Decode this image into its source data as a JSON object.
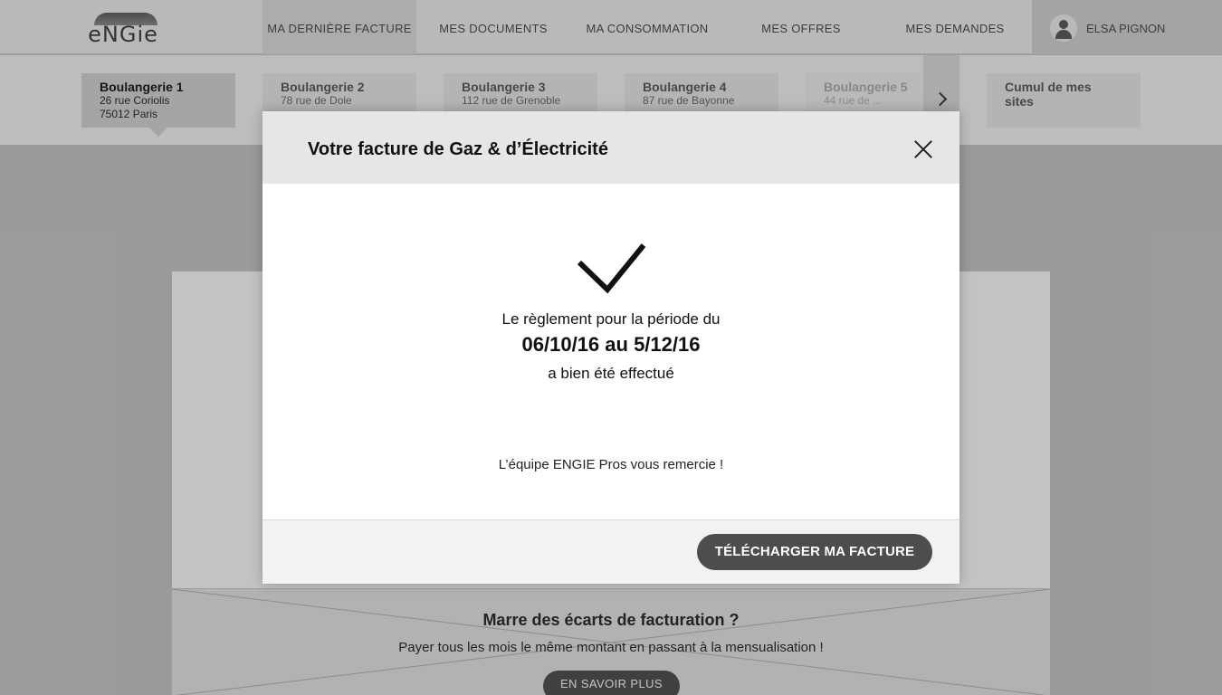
{
  "brand": {
    "logo_text": "eNGie"
  },
  "nav": {
    "items": [
      {
        "label": "MA DERNIÈRE FACTURE"
      },
      {
        "label": "MES DOCUMENTS"
      },
      {
        "label": "MA CONSOMMATION"
      },
      {
        "label": "MES OFFRES"
      },
      {
        "label": "MES DEMANDES"
      }
    ],
    "user_name": "ELSA PIGNON"
  },
  "sites": {
    "cards": [
      {
        "name": "Boulangerie 1",
        "street": "26 rue Coriolis",
        "city": "75012 Paris"
      },
      {
        "name": "Boulangerie 2",
        "street": "78 rue de Dole"
      },
      {
        "name": "Boulangerie 3",
        "street": "112 rue de Grenoble"
      },
      {
        "name": "Boulangerie 4",
        "street": "87 rue de Bayonne"
      },
      {
        "name": "Boulangerie 5",
        "street": "44 rue de ..."
      }
    ],
    "total_label": "Cumul de mes sites"
  },
  "promo": {
    "title": "Marre des écarts de facturation ?",
    "text": "Payer tous les mois le même montant en passant à la mensualisation !",
    "button": "EN SAVOIR PLUS"
  },
  "modal": {
    "title": "Votre facture de Gaz & d’Électricité",
    "line1": "Le règlement pour la période du",
    "dates": "06/10/16 au 5/12/16",
    "line3": "a bien été effectué",
    "thanks": "L’équipe ENGIE Pros vous remercie !",
    "download_button": "TÉLÉCHARGER MA FACTURE"
  },
  "icons": {
    "close": "close-icon",
    "check": "check-icon",
    "next": "chevron-right-icon",
    "user": "user-icon"
  }
}
